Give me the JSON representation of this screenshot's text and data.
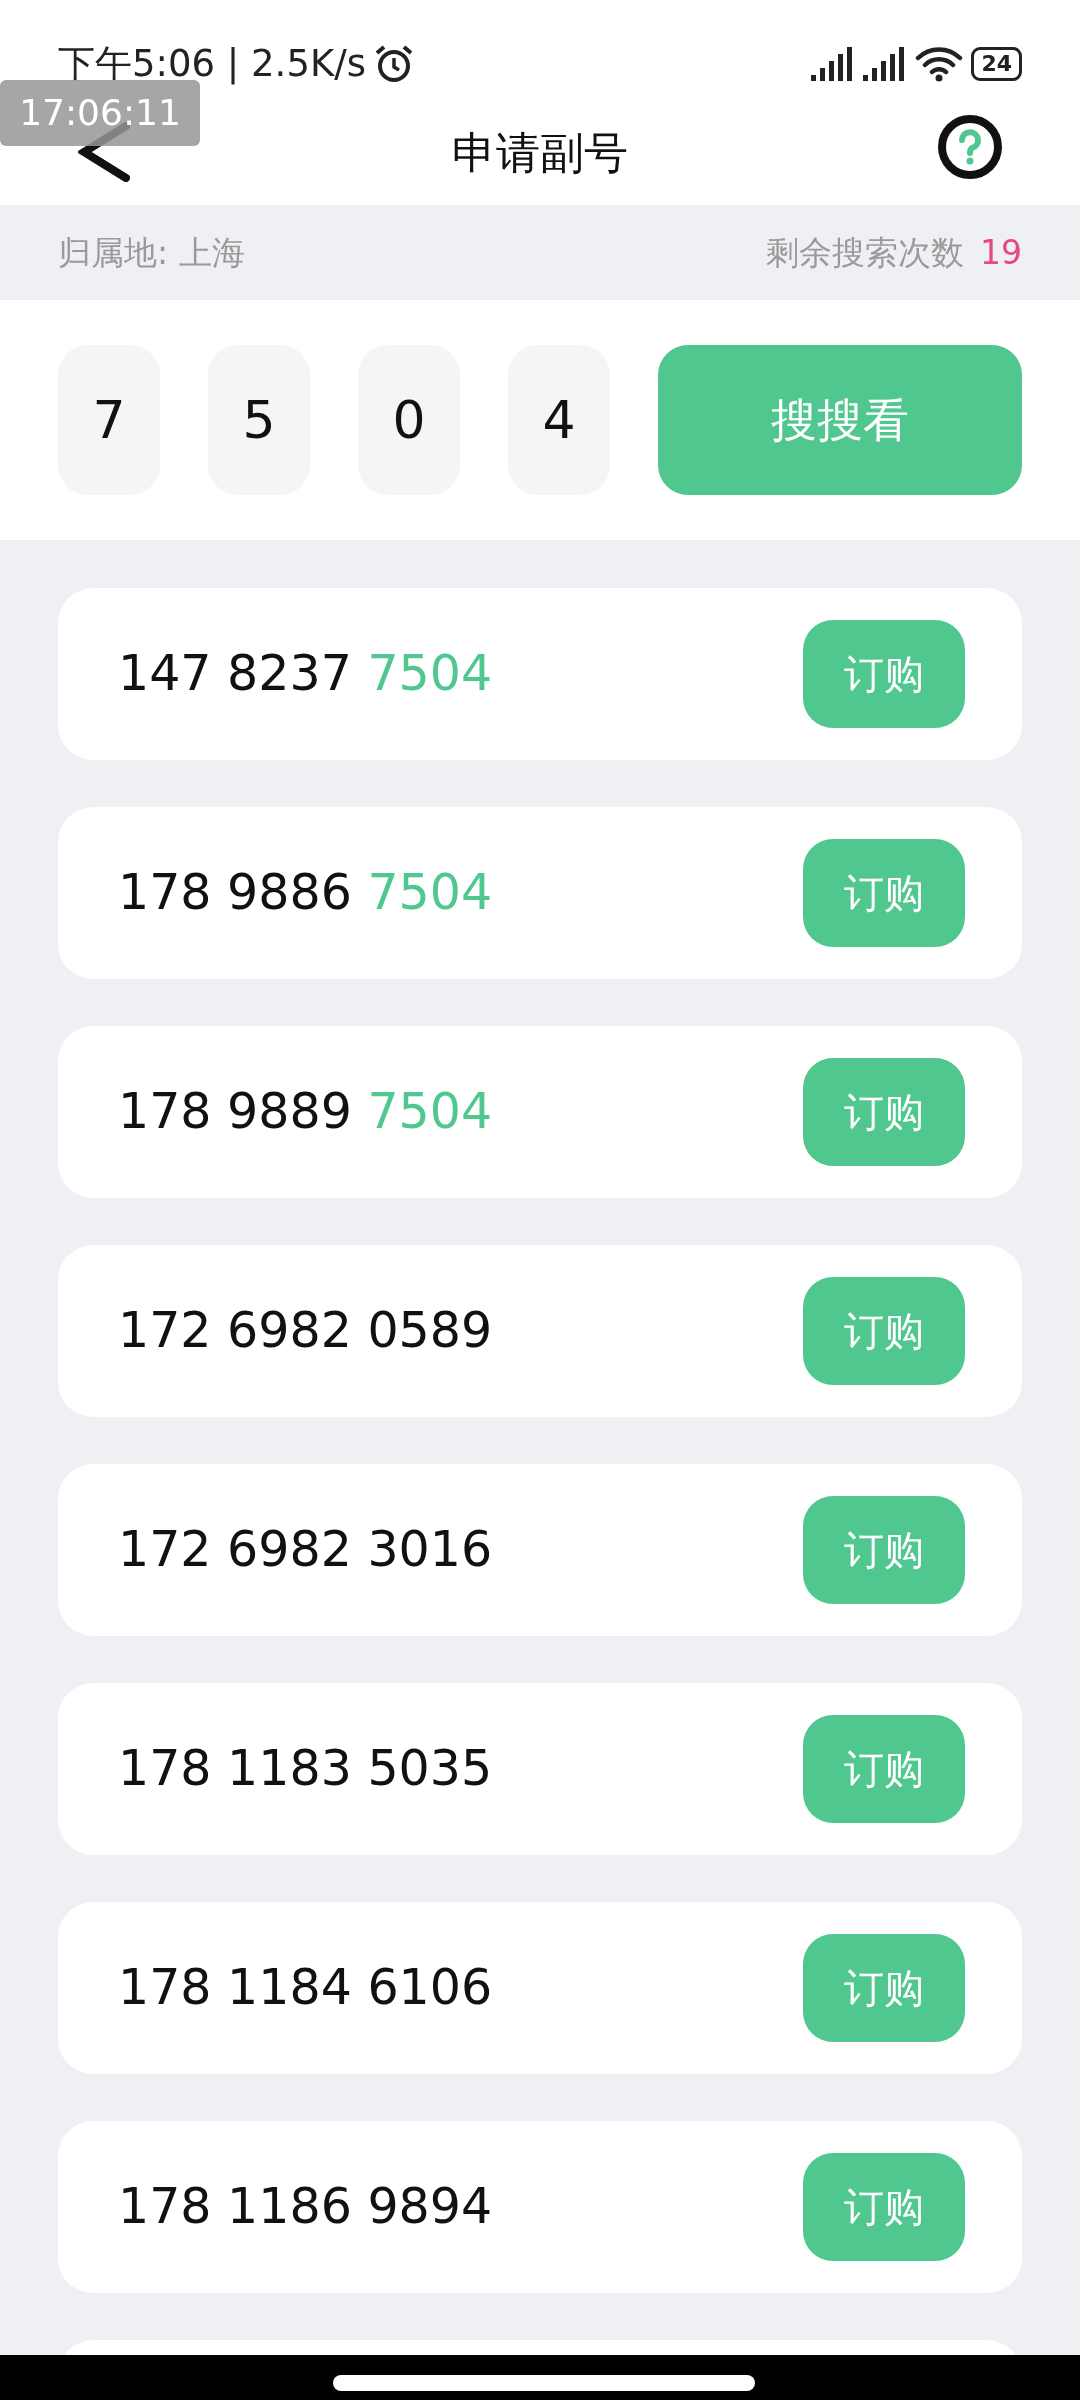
{
  "status_bar": {
    "time": "下午5:06 | 2.5K/s",
    "battery": "24"
  },
  "overlay_time": "17:06:11",
  "header": {
    "title": "申请副号"
  },
  "info_bar": {
    "location": "归属地: 上海",
    "remaining_label": "剩余搜索次数",
    "remaining_count": "19"
  },
  "search": {
    "digits": [
      "7",
      "5",
      "0",
      "4"
    ],
    "button": "搜搜看"
  },
  "numbers": [
    {
      "number": "147 8237",
      "match": "7504",
      "button": "订购"
    },
    {
      "number": "178 9886",
      "match": "7504",
      "button": "订购"
    },
    {
      "number": "178 9889",
      "match": "7504",
      "button": "订购"
    },
    {
      "number": "172 6982 0589",
      "button": "订购"
    },
    {
      "number": "172 6982 3016",
      "button": "订购"
    },
    {
      "number": "178 1183 5035",
      "button": "订购"
    },
    {
      "number": "178 1184 6106",
      "button": "订购"
    },
    {
      "number": "178 1186 9894",
      "button": "订购"
    }
  ]
}
